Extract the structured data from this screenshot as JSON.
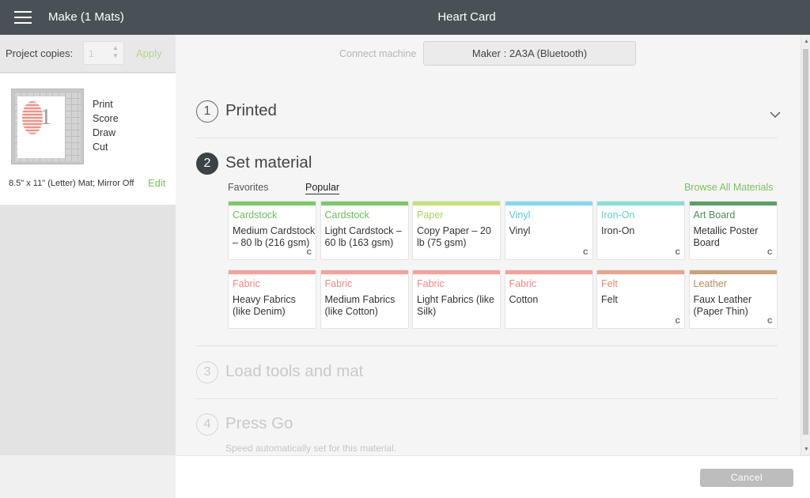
{
  "header": {
    "menu_icon": "hamburger-menu-icon",
    "left_title": "Make (1 Mats)",
    "center_title": "Heart Card"
  },
  "sidebar": {
    "copies_label": "Project copies:",
    "copies_value": "1",
    "apply_label": "Apply",
    "operations": [
      "Print",
      "Score",
      "Draw",
      "Cut"
    ],
    "mat_number": "1",
    "mat_description": "8.5\" x 11\" (Letter) Mat; Mirror Off",
    "edit_label": "Edit"
  },
  "machine": {
    "connect_label": "Connect machine",
    "selected": "Maker : 2A3A (Bluetooth)"
  },
  "steps": [
    {
      "number": "1",
      "title": "Printed"
    },
    {
      "number": "2",
      "title": "Set material"
    },
    {
      "number": "3",
      "title": "Load tools and mat"
    },
    {
      "number": "4",
      "title": "Press Go",
      "note": "Speed automatically set for this material."
    }
  ],
  "material": {
    "tabs": [
      "Favorites",
      "Popular"
    ],
    "selected_tab": "Popular",
    "browse_all": "Browse All Materials",
    "cards": [
      {
        "category": "Cardstock",
        "name": "Medium Cardstock – 80 lb (216 gsm)",
        "stripe": "#7cc86a",
        "color": "#6dbb5a",
        "badge": "c"
      },
      {
        "category": "Cardstock",
        "name": "Light Cardstock – 60 lb (163 gsm)",
        "stripe": "#7cc86a",
        "color": "#6dbb5a",
        "badge": ""
      },
      {
        "category": "Paper",
        "name": "Copy Paper – 20 lb (75 gsm)",
        "stripe": "#c3e27d",
        "color": "#a9cf62",
        "badge": ""
      },
      {
        "category": "Vinyl",
        "name": "Vinyl",
        "stripe": "#88d8ec",
        "color": "#5ec4df",
        "badge": "c"
      },
      {
        "category": "Iron-On",
        "name": "Iron-On",
        "stripe": "#87dfd5",
        "color": "#5fcfc2",
        "badge": "c"
      },
      {
        "category": "Art Board",
        "name": "Metallic Poster Board",
        "stripe": "#5aa064",
        "color": "#4a8f55",
        "badge": "c"
      },
      {
        "category": "Fabric",
        "name": "Heavy Fabrics (like Denim)",
        "stripe": "#f2a39c",
        "color": "#ec8a82",
        "badge": ""
      },
      {
        "category": "Fabric",
        "name": "Medium Fabrics (like Cotton)",
        "stripe": "#f2a39c",
        "color": "#ec8a82",
        "badge": ""
      },
      {
        "category": "Fabric",
        "name": "Light Fabrics (like Silk)",
        "stripe": "#f2a39c",
        "color": "#ec8a82",
        "badge": ""
      },
      {
        "category": "Fabric",
        "name": "Cotton",
        "stripe": "#f2a39c",
        "color": "#ec8a82",
        "badge": ""
      },
      {
        "category": "Felt",
        "name": "Felt",
        "stripe": "#e7a58e",
        "color": "#df8d70",
        "badge": "c"
      },
      {
        "category": "Leather",
        "name": "Faux Leather (Paper Thin)",
        "stripe": "#c9a27a",
        "color": "#b78b5f",
        "badge": "c"
      }
    ]
  },
  "footer": {
    "cancel_label": "Cancel"
  },
  "colors": {
    "accent_green": "#7cc25c",
    "header_bg": "#4a5156"
  }
}
